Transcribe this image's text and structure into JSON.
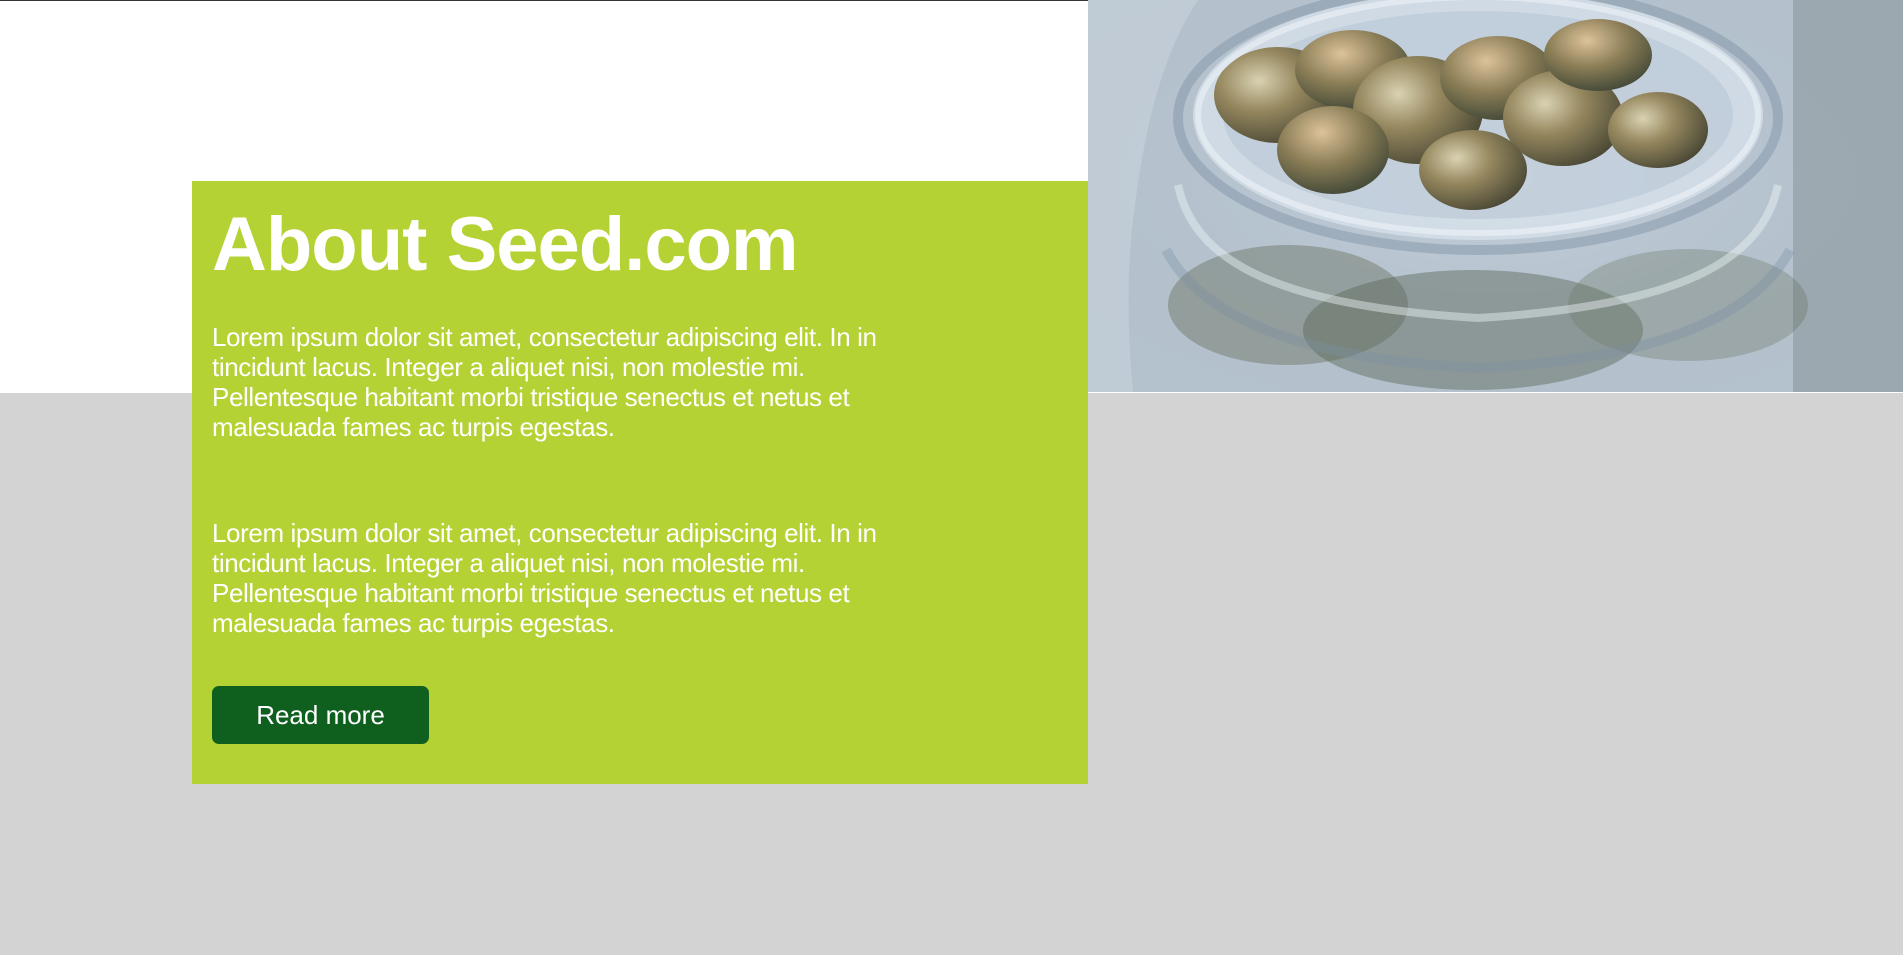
{
  "about": {
    "title": "About Seed.com",
    "paragraph_1": "Lorem ipsum dolor sit amet, consectetur adipiscing elit. In in tincidunt lacus. Integer a aliquet nisi, non molestie mi. Pellentesque habitant morbi tristique senectus et netus et malesuada fames ac turpis egestas.",
    "paragraph_2": "Lorem ipsum dolor sit amet, consectetur adipiscing elit. In in tincidunt lacus. Integer a aliquet nisi, non molestie mi. Pellentesque habitant morbi tristique senectus et netus et malesuada fames ac turpis egestas.",
    "button_label": "Read more"
  },
  "colors": {
    "accent_green": "#b4d233",
    "button_green": "#0f5f1f",
    "background_gray": "#d3d3d3",
    "white": "#ffffff"
  },
  "image": {
    "alt": "Glass jar with dried cannabis buds"
  }
}
